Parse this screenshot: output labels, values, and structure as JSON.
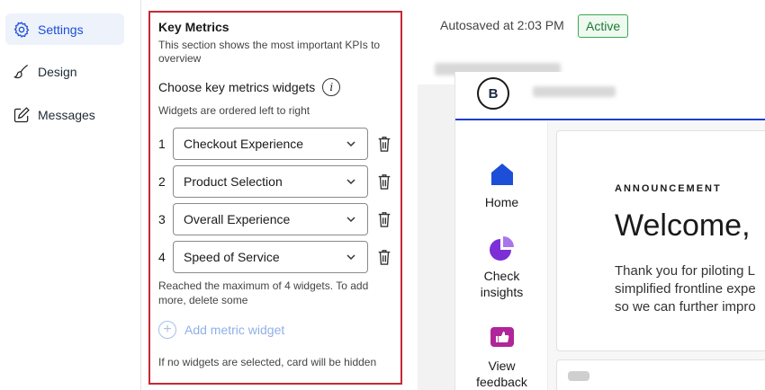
{
  "nav": {
    "items": [
      {
        "label": "Settings",
        "icon": "gear-icon",
        "active": true
      },
      {
        "label": "Design",
        "icon": "brush-icon",
        "active": false
      },
      {
        "label": "Messages",
        "icon": "edit-icon",
        "active": false
      }
    ]
  },
  "panel": {
    "title": "Key Metrics",
    "description": "This section shows the most important KPIs to overview",
    "section_label": "Choose key metrics widgets",
    "info_glyph": "i",
    "hint": "Widgets are ordered left to right",
    "widgets": [
      {
        "number": "1",
        "value": "Checkout Experience"
      },
      {
        "number": "2",
        "value": "Product Selection"
      },
      {
        "number": "3",
        "value": "Overall Experience"
      },
      {
        "number": "4",
        "value": "Speed of Service"
      }
    ],
    "max_note": "Reached the maximum of 4 widgets. To add more, delete some",
    "add_label": "Add metric widget",
    "hidden_note": "If no widgets are selected, card will be hidden"
  },
  "status": {
    "autosave": "Autosaved at 2:03 PM",
    "badge": "Active"
  },
  "preview": {
    "logo_letter": "B",
    "side_items": [
      {
        "label": "Home",
        "icon": "home-icon"
      },
      {
        "label": "Check insights",
        "icon": "pie-chart-icon"
      },
      {
        "label": "View feedback",
        "icon": "feedback-icon"
      }
    ],
    "announcement_label": "ANNOUNCEMENT",
    "announcement_title": "Welcome,",
    "announcement_body": [
      "Thank you for piloting L",
      "simplified frontline expe",
      "so we can further impro"
    ]
  },
  "colors": {
    "accent": "#1b4fd6",
    "panel_border": "#c62835",
    "active_badge": "#3aa94f",
    "icon_blue": "#1d4ed8",
    "icon_purple": "#7c2fd6",
    "icon_magenta": "#b0259a"
  }
}
